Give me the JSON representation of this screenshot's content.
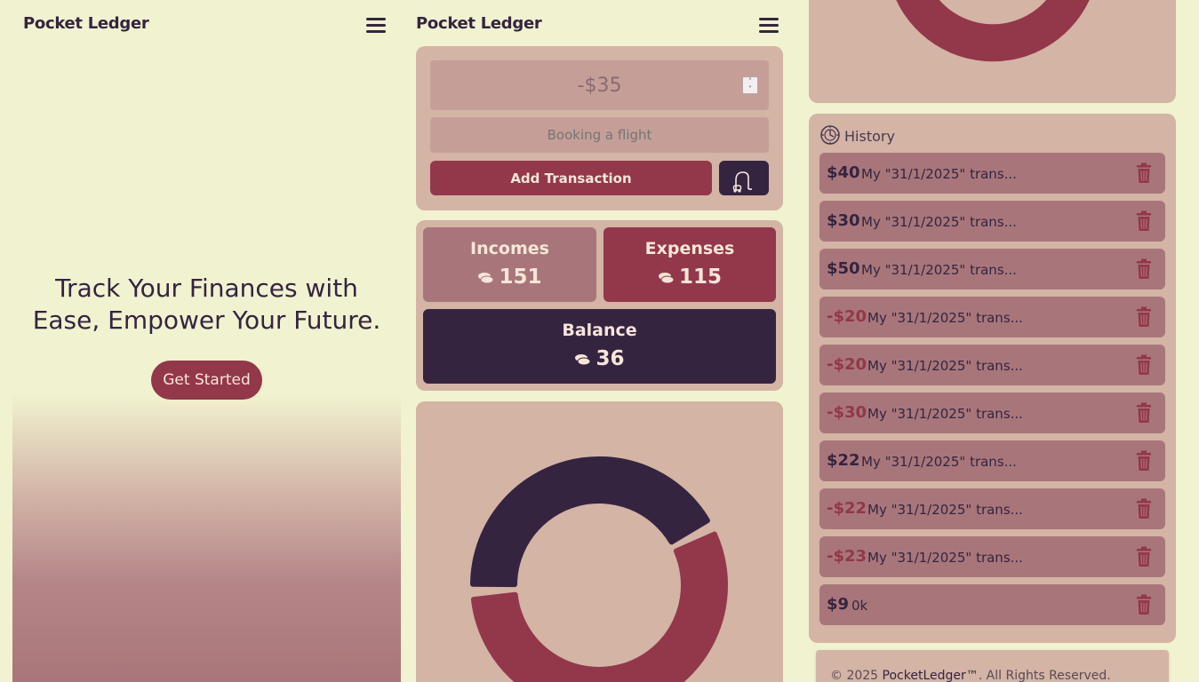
{
  "app": {
    "title": "Pocket Ledger"
  },
  "hero": {
    "heading_line1": "Track Your Finances with",
    "heading_line2": "Ease, Empower Your Future.",
    "cta_label": "Get Started"
  },
  "form": {
    "amount_value": "-$35",
    "description_placeholder": "Booking a flight",
    "add_label": "Add Transaction",
    "clean_icon": "vacuum-cleaner-icon"
  },
  "summary": {
    "incomes_label": "Incomes",
    "incomes_value": "151",
    "expenses_label": "Expenses",
    "expenses_value": "115",
    "balance_label": "Balance",
    "balance_value": "36"
  },
  "chart_data": {
    "type": "pie",
    "categories": [
      "Incomes",
      "Expenses"
    ],
    "values": [
      151,
      115
    ],
    "colors": {
      "Incomes": "#93374a",
      "Expenses": "#352440"
    }
  },
  "history": {
    "title": "History",
    "items": [
      {
        "amount": "$40",
        "desc": "My \"31/1/2025\" trans...",
        "sign": "pos"
      },
      {
        "amount": "$30",
        "desc": "My \"31/1/2025\" trans...",
        "sign": "pos"
      },
      {
        "amount": "$50",
        "desc": "My \"31/1/2025\" trans...",
        "sign": "pos"
      },
      {
        "amount": "-$20",
        "desc": "My \"31/1/2025\" trans...",
        "sign": "neg"
      },
      {
        "amount": "-$20",
        "desc": "My \"31/1/2025\" trans...",
        "sign": "neg"
      },
      {
        "amount": "-$30",
        "desc": "My \"31/1/2025\" trans...",
        "sign": "neg"
      },
      {
        "amount": "$22",
        "desc": "My \"31/1/2025\" trans...",
        "sign": "pos"
      },
      {
        "amount": "-$22",
        "desc": "My \"31/1/2025\" trans...",
        "sign": "neg"
      },
      {
        "amount": "-$23",
        "desc": "My \"31/1/2025\" trans...",
        "sign": "neg"
      },
      {
        "amount": "$9",
        "desc": "0k",
        "sign": "pos"
      }
    ]
  },
  "footer": {
    "prefix": "© 2025 ",
    "brand": "PocketLedger™",
    "suffix": ". All Rights Reserved."
  },
  "colors": {
    "background": "#f1f2d0",
    "primary": "#93374a",
    "dark": "#352440",
    "card": "#d3b4a5",
    "muted": "#a8767a"
  }
}
